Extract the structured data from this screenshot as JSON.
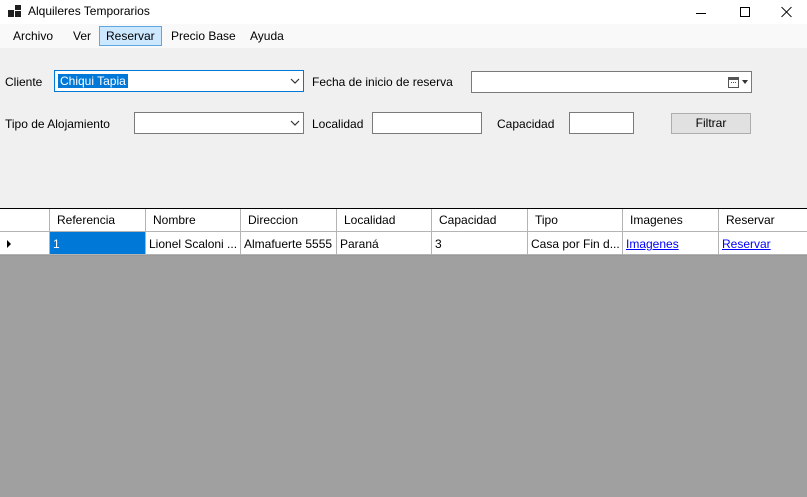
{
  "window": {
    "title": "Alquileres Temporarios"
  },
  "menu": {
    "items": [
      {
        "label": "Archivo"
      },
      {
        "label": "Ver"
      },
      {
        "label": "Reservar",
        "active": true
      },
      {
        "label": "Precio Base"
      },
      {
        "label": "Ayuda"
      }
    ]
  },
  "form": {
    "cliente_label": "Cliente",
    "cliente_value": "Chiqui Tapia",
    "fecha_label": "Fecha de inicio de reserva",
    "fecha_value": "",
    "tipo_label": "Tipo de Alojamiento",
    "tipo_value": "",
    "localidad_label": "Localidad",
    "localidad_value": "",
    "capacidad_label": "Capacidad",
    "capacidad_value": "",
    "filtrar_label": "Filtrar"
  },
  "grid": {
    "columns": [
      "Referencia",
      "Nombre",
      "Direccion",
      "Localidad",
      "Capacidad",
      "Tipo",
      "Imagenes",
      "Reservar"
    ],
    "rows": [
      {
        "referencia": "1",
        "nombre": "Lionel Scaloni ...",
        "direccion": "Almafuerte 5555",
        "localidad": "Paraná",
        "capacidad": "3",
        "tipo": "Casa por Fin d...",
        "imagenes": "Imagenes",
        "reservar": "Reservar"
      }
    ]
  },
  "colors": {
    "selection": "#0078d7",
    "menu_active": "#cce8ff",
    "grid_background": "#a0a0a0",
    "link": "#0000ff"
  }
}
